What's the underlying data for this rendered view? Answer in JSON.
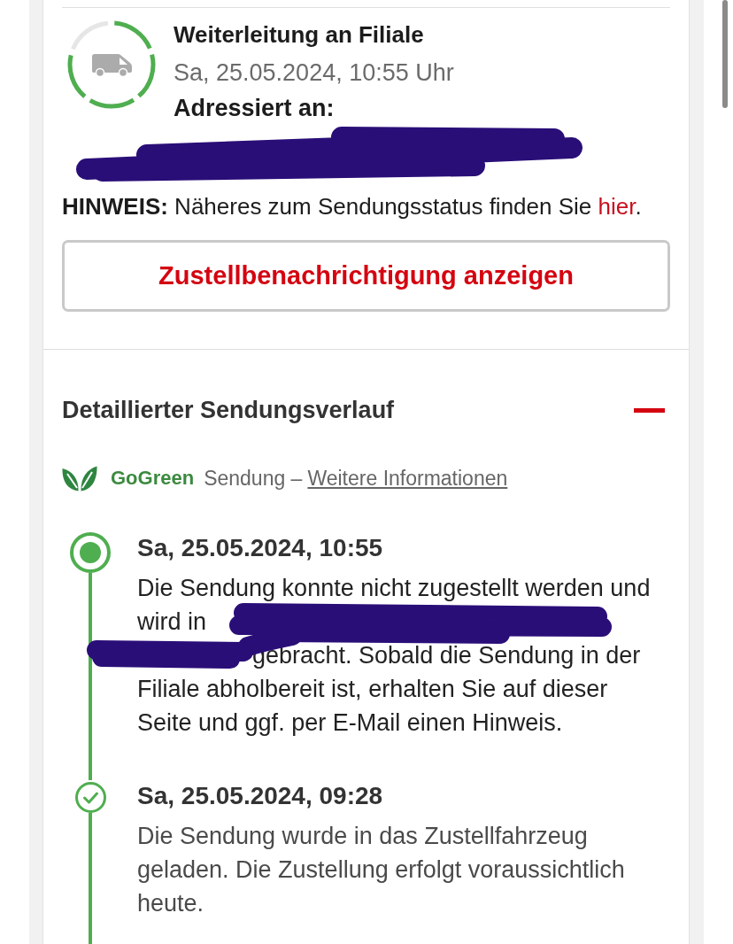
{
  "status": {
    "steps": [
      {
        "done": true
      },
      {
        "done": true
      },
      {
        "done": true
      },
      {
        "done": true
      },
      {
        "done": false
      }
    ],
    "title": "Weiterleitung an Filiale",
    "date": "Sa, 25.05.2024, 10:55 Uhr",
    "address_label": "Adressiert an:",
    "address_redacted": true
  },
  "notice": {
    "text": "**HINWEIS:** Näheres zum Sendungsstatus finden Sie",
    "link": "hier",
    "after": "."
  },
  "notification_button": "Zustellbenachrichtigung anzeigen",
  "history": {
    "title": "Detaillierter Sendungsverlauf",
    "expanded": true,
    "badge": "GoGreen",
    "badge_text": "Sendung –",
    "link": "Weitere Informationen",
    "events": [
      {
        "time": "Sa, 25.05.2024, 10:55",
        "current": true,
        "redacted": true,
        "description": [
          "Die Sendung konnte nicht zugestellt werden und wird in",
          "gebracht. Sobald die Sendung in der Filiale abholbereit ist, erhalten Sie auf dieser Seite und ggf. per E-Mail einen Hinweis."
        ]
      },
      {
        "time": "Sa, 25.05.2024, 09:28",
        "current": false,
        "redacted": false,
        "description": [
          "Die Sendung wurde in das Zustellfahrzeug geladen. Die Zustellung erfolgt voraussichtlich heute."
        ]
      }
    ]
  }
}
